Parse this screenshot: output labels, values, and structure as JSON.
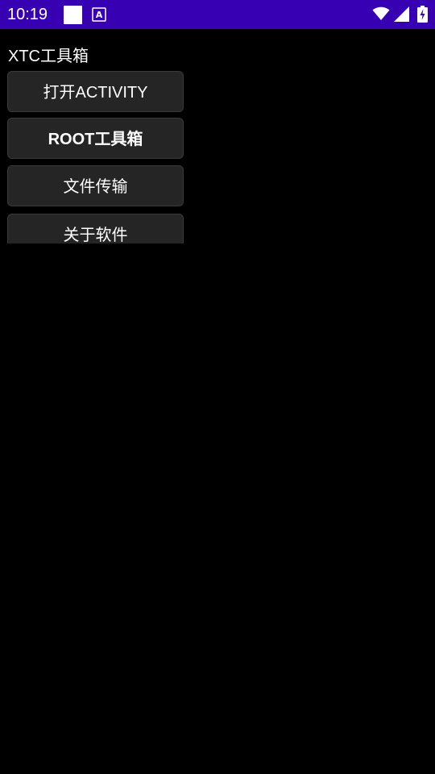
{
  "status_bar": {
    "time": "10:19",
    "background_color": "#3700b3",
    "notification_icons": [
      "blank-notification-icon",
      "a-notification-icon"
    ],
    "system_icons": [
      "wifi-icon",
      "cellular-signal-icon",
      "battery-charging-icon"
    ]
  },
  "app": {
    "title": "XTC工具箱"
  },
  "buttons": [
    {
      "label": "打开ACTIVITY"
    },
    {
      "label": "ROOT工具箱"
    },
    {
      "label": "文件传输"
    },
    {
      "label": "关于软件"
    }
  ]
}
